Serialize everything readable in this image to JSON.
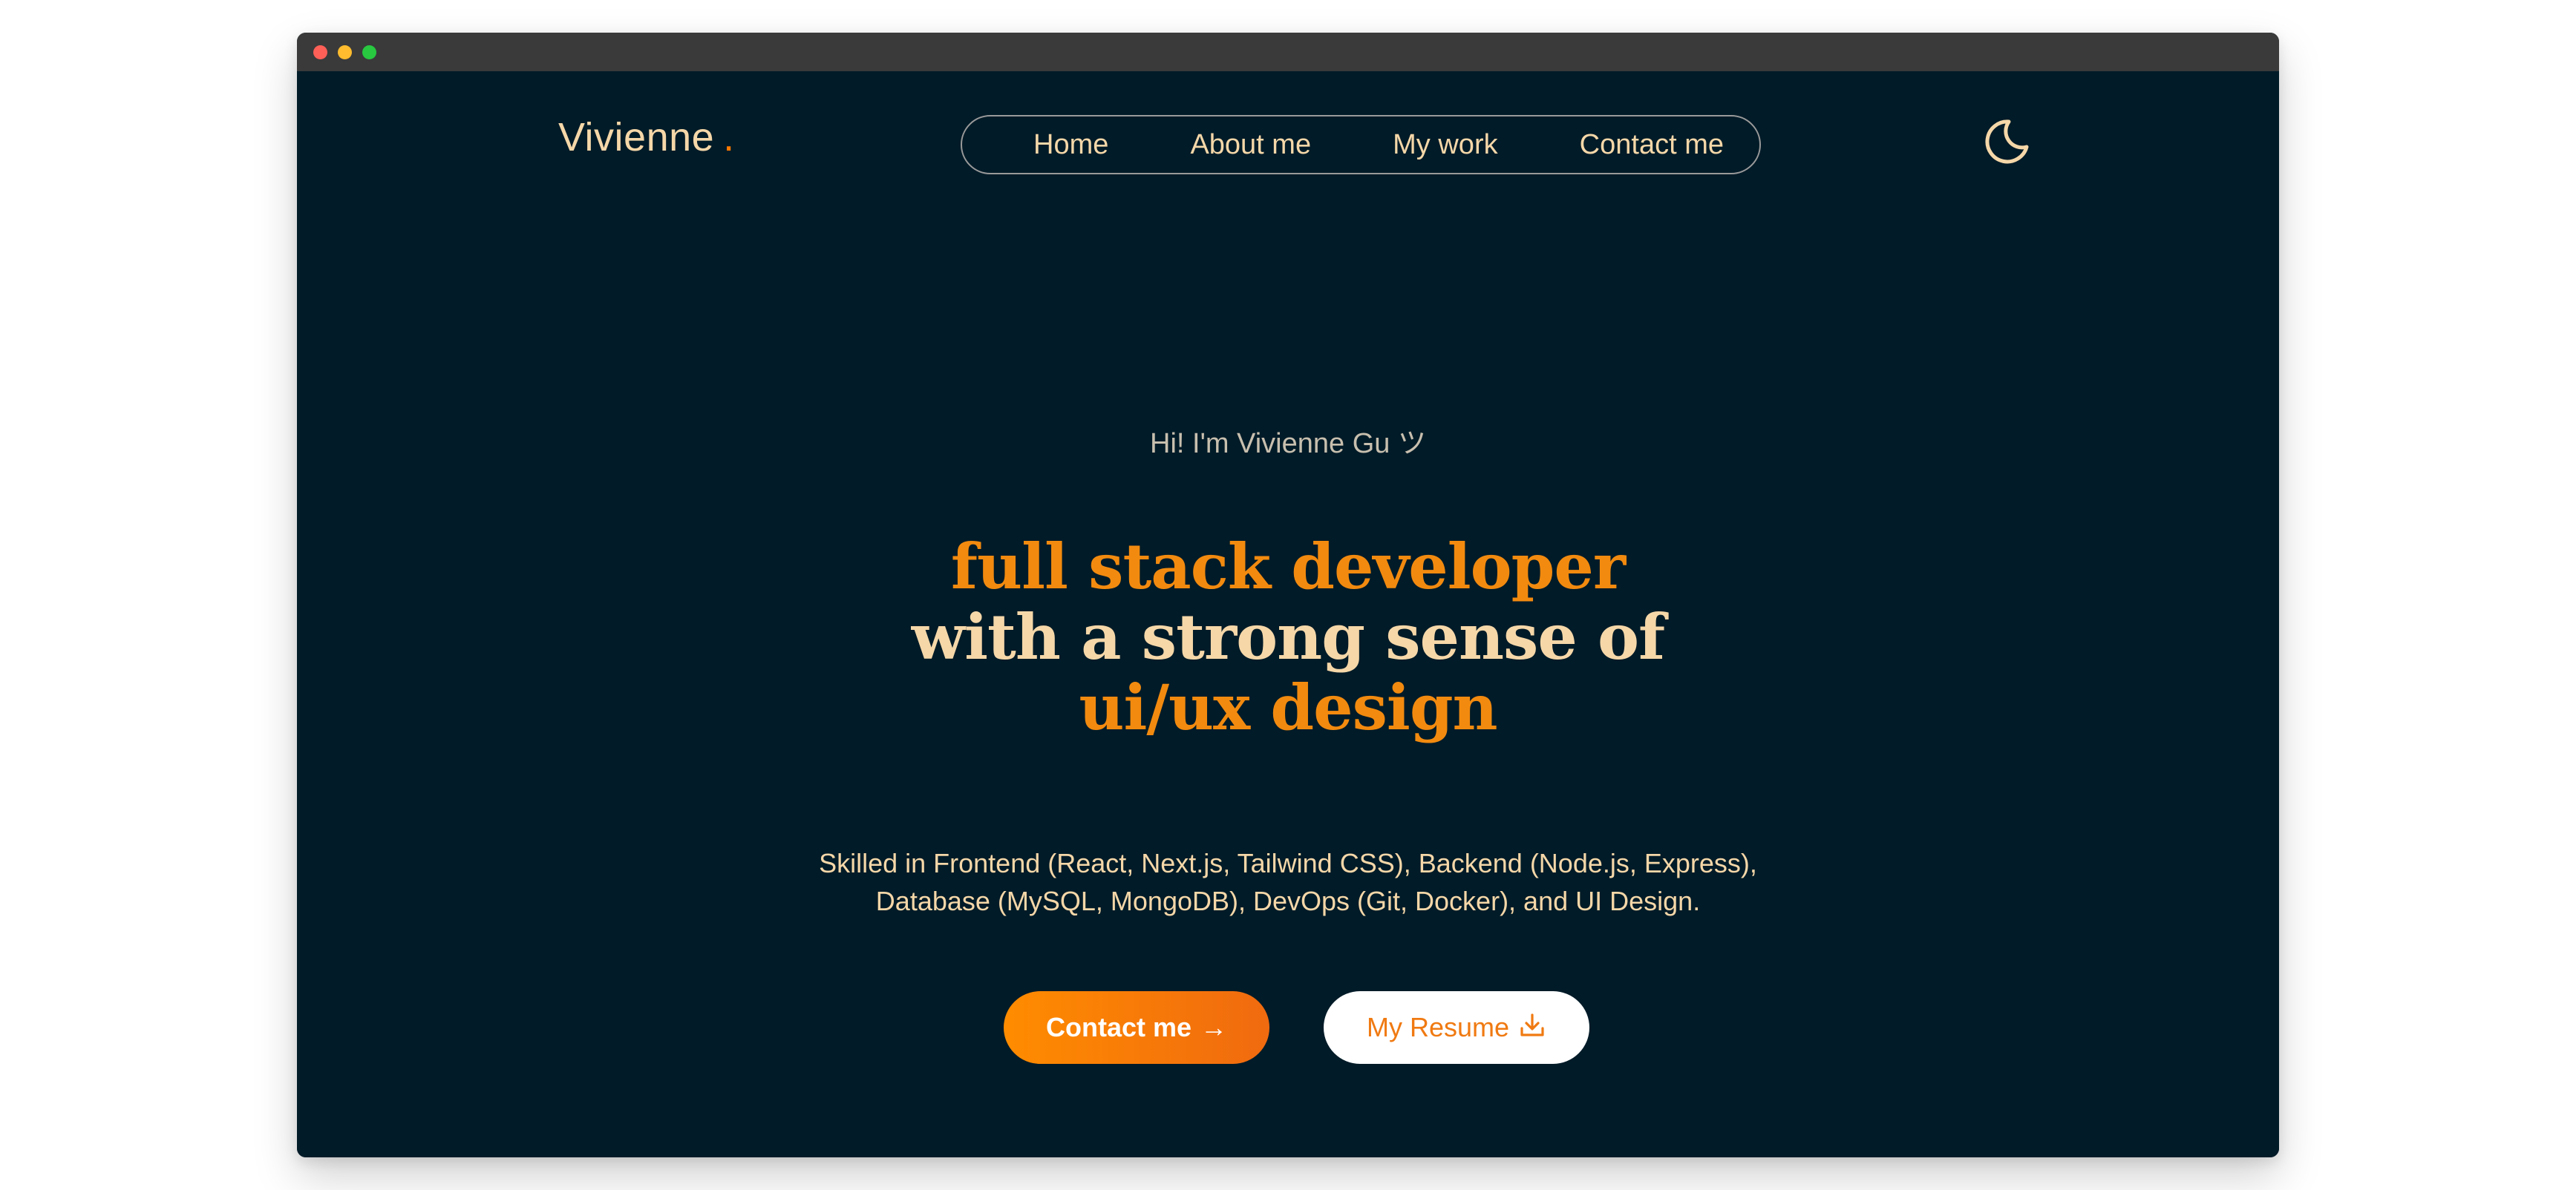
{
  "window": {
    "traffic_lights": [
      "close",
      "minimize",
      "maximize"
    ]
  },
  "header": {
    "logo_text": "Vivienne",
    "logo_dot": ".",
    "nav": [
      {
        "label": "Home"
      },
      {
        "label": "About me"
      },
      {
        "label": "My work"
      },
      {
        "label": "Contact me"
      }
    ],
    "theme_toggle_icon": "moon-icon"
  },
  "hero": {
    "greeting": "Hi! I'm Vivienne Gu ツ",
    "headline_line1": "full stack developer",
    "headline_line2": "with a strong sense of",
    "headline_line3": "ui/ux design",
    "skills_line1": "Skilled in Frontend (React, Next.js, Tailwind CSS), Backend (Node.js, Express),",
    "skills_line2": "Database (MySQL, MongoDB), DevOps (Git, Docker), and UI Design.",
    "contact_button": "Contact me",
    "contact_icon": "→",
    "resume_button": "My Resume",
    "resume_icon": "download-icon"
  },
  "colors": {
    "background": "#011b28",
    "accent_orange": "#f28a0f",
    "cream": "#f5d7a8",
    "titlebar": "#3a3a3a"
  }
}
